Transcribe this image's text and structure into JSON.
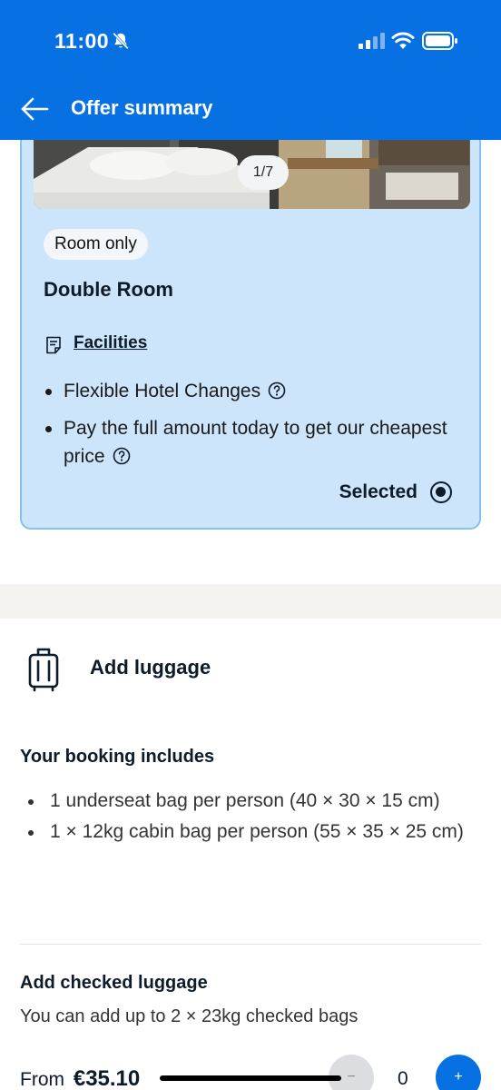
{
  "status_bar": {
    "time": "11:00"
  },
  "header": {
    "title": "Offer summary"
  },
  "room_card": {
    "photo_counter": "1/7",
    "board_type": "Room only",
    "room_name": "Double Room",
    "facilities_link": "Facilities",
    "features": [
      "Flexible Hotel Changes",
      "Pay the full amount today to get our cheapest price"
    ],
    "selected_label": "Selected"
  },
  "luggage": {
    "title": "Add luggage",
    "includes_title": "Your booking includes",
    "includes": [
      "1 underseat bag per person (40 × 30 × 15 cm)",
      "1 × 12kg cabin bag per person (55 × 35 × 25 cm)"
    ],
    "checked_title": "Add checked luggage",
    "checked_subtitle": "You can add up to 2 × 23kg checked bags",
    "from_label": "From",
    "from_price": "€35.10",
    "minus_label": "−",
    "quantity": "0",
    "plus_label": "+"
  },
  "colors": {
    "brand_blue": "#0770e3",
    "card_fill": "#cde5fb",
    "card_border": "#84c0f5"
  },
  "icons": [
    "bell-off-icon",
    "signal-icon",
    "wifi-icon",
    "battery-icon",
    "back-arrow-icon",
    "facilities-icon",
    "help-icon",
    "radio-selected-icon",
    "luggage-icon"
  ]
}
